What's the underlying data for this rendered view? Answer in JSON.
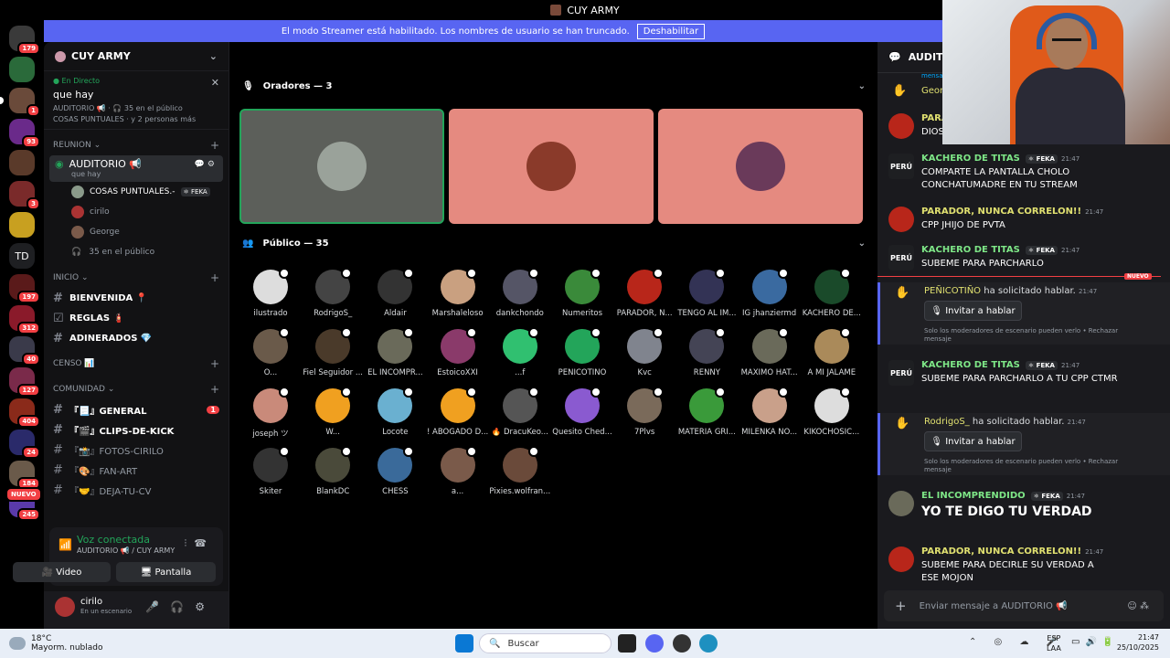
{
  "window": {
    "title": "CUY ARMY"
  },
  "banner": {
    "text": "El modo Streamer está habilitado. Los nombres de usuario se han truncado.",
    "button": "Deshabilitar"
  },
  "servers": [
    {
      "label": "",
      "badge": "179",
      "color": "#3a3a3a"
    },
    {
      "label": "",
      "badge": "",
      "color": "#2a6a3a"
    },
    {
      "label": "",
      "badge": "1",
      "color": "#6a4a3a"
    },
    {
      "label": "",
      "badge": "93",
      "color": "#6a2a8a"
    },
    {
      "label": "",
      "badge": "",
      "color": "#5a3a2a"
    },
    {
      "label": "",
      "badge": "3",
      "color": "#7a2a2a"
    },
    {
      "label": "",
      "badge": "",
      "color": "#c8a020"
    },
    {
      "label": "TD",
      "badge": "",
      "color": "#1e1f22"
    },
    {
      "label": "",
      "badge": "197",
      "color": "#5a1a1a"
    },
    {
      "label": "",
      "badge": "312",
      "color": "#8a1a2a"
    },
    {
      "label": "",
      "badge": "40",
      "color": "#3a3a4a"
    },
    {
      "label": "",
      "badge": "127",
      "color": "#7a2a4a"
    },
    {
      "label": "",
      "badge": "404",
      "color": "#8a2a1a"
    },
    {
      "label": "",
      "badge": "24",
      "color": "#2a2a6a"
    },
    {
      "label": "",
      "badge": "184",
      "color": "#6a5a4a"
    },
    {
      "label": "",
      "badge": "245",
      "color": "#5a3aaa"
    }
  ],
  "servers_new": "NUEVO",
  "sidebar": {
    "server_name": "CUY ARMY",
    "live": {
      "status": "En Directo",
      "title": "que hay",
      "sub1": "AUDITORIO 📢 · 🎧 35 en el público",
      "sub2": "COSAS PUNTUALES · y 2 personas más"
    },
    "cat_reunion": "REUNION",
    "voice_channel": {
      "name": "AUDITORIO 📢",
      "status": "que hay"
    },
    "voice_users": [
      {
        "name": "COSAS PUNTUALES.-",
        "tag": "FEKA",
        "color": "#8a9a8a"
      },
      {
        "name": "cirilo",
        "tag": "",
        "color": "#a33"
      },
      {
        "name": "George",
        "tag": "",
        "color": "#7a5a4a"
      }
    ],
    "audience": "35 en el público",
    "cat_inicio": "INICIO",
    "inicio_channels": [
      {
        "icon": "#",
        "name": "BIENVENIDA 📍",
        "count": ""
      },
      {
        "icon": "☑",
        "name": "REGLAS 🧯",
        "count": ""
      },
      {
        "icon": "#",
        "name": "ADINERADOS 💎",
        "count": ""
      }
    ],
    "cat_censo": "CENSO 📊",
    "cat_comunidad": "COMUNIDAD",
    "comunidad_channels": [
      {
        "icon": "#",
        "name": "『📃』GENERAL",
        "count": "1",
        "bold": true
      },
      {
        "icon": "#",
        "name": "『🎬』CLIPS-DE-KICK",
        "count": "",
        "bold": true
      },
      {
        "icon": "#",
        "name": "『📸』FOTOS-CIRILO",
        "count": "",
        "bold": false
      },
      {
        "icon": "#",
        "name": "『🎨』FAN-ART",
        "count": "",
        "bold": false
      },
      {
        "icon": "#",
        "name": "『🤝』DEJA-TU-CV",
        "count": "",
        "bold": false
      }
    ]
  },
  "voice_panel": {
    "status": "Voz conectada",
    "location": "AUDITORIO 📢 / CUY ARMY",
    "video": "Video",
    "screen": "Pantalla"
  },
  "user_panel": {
    "name": "cirilo",
    "status": "En un escenario"
  },
  "stage": {
    "speakers_header": "Oradores — 3",
    "speakers": [
      {
        "bg": "#5c5f5a",
        "face": "#9aa29a",
        "selected": true
      },
      {
        "bg": "#e58a80",
        "face": "#8a3a2a",
        "selected": false
      },
      {
        "bg": "#e58a80",
        "face": "#6a3a5a",
        "selected": false
      }
    ],
    "public_header": "Público — 35",
    "audience": [
      {
        "name": "ilustrado",
        "c": "#ddd"
      },
      {
        "name": "RodrigoS_",
        "c": "#444"
      },
      {
        "name": "Aldair",
        "c": "#333"
      },
      {
        "name": "Marshaleloso",
        "c": "#c9a080"
      },
      {
        "name": "dankchondo",
        "c": "#556"
      },
      {
        "name": "Numeritos",
        "c": "#3a8a3a"
      },
      {
        "name": "PARADOR, N...",
        "c": "#b8261a"
      },
      {
        "name": "TENGO AL IM...",
        "c": "#335"
      },
      {
        "name": "IG jhanziermd",
        "c": "#3a6aa0"
      },
      {
        "name": "KACHERO DE...",
        "c": "#1a4a2a"
      },
      {
        "name": "O...",
        "c": "#6a5a4a"
      },
      {
        "name": "Fiel Seguidor ...",
        "c": "#4a3a2a"
      },
      {
        "name": "EL INCOMPR...",
        "c": "#6a6a5a"
      },
      {
        "name": "EstoicoXXI",
        "c": "#8a3a6a"
      },
      {
        "name": "...f",
        "c": "#30c070"
      },
      {
        "name": "PEÑICOTIÑO",
        "c": "#23a55a"
      },
      {
        "name": "Kvc",
        "c": "#80848e"
      },
      {
        "name": "RENNY",
        "c": "#445"
      },
      {
        "name": "MAXIMO HAT...",
        "c": "#6a6a5a"
      },
      {
        "name": "A MI JALAME",
        "c": "#aa8a5a"
      },
      {
        "name": "joseph ツ",
        "c": "#c98a7a"
      },
      {
        "name": "W...",
        "c": "#f0a020"
      },
      {
        "name": "Locote",
        "c": "#6ab0d0"
      },
      {
        "name": "! ABOGADO D...",
        "c": "#f0a020"
      },
      {
        "name": "🔥 DracuKeo...",
        "c": "#555"
      },
      {
        "name": "Quesito Ched...",
        "c": "#8a5ad0"
      },
      {
        "name": "7Plvs",
        "c": "#7a6a5a"
      },
      {
        "name": "MATERIA GRI...",
        "c": "#3a9a3a"
      },
      {
        "name": "MILENKA NO...",
        "c": "#c9a08a"
      },
      {
        "name": "KIKOCHOSIC...",
        "c": "#ddd"
      },
      {
        "name": "Skiter",
        "c": "#333"
      },
      {
        "name": "BlankDC",
        "c": "#4a4a3a"
      },
      {
        "name": "CHESS",
        "c": "#3a6a9a"
      },
      {
        "name": "a...",
        "c": "#7a5a4a"
      },
      {
        "name": "Pixies.wolfran...",
        "c": "#6a4a3a"
      }
    ]
  },
  "chat": {
    "channel": "AUDITORIO",
    "partial_top": "mensaje",
    "partial_george": "Georg",
    "partial_parador": "PARA",
    "partial_dios": "DIOS",
    "messages": [
      {
        "author": "KACHERO DE TITAS",
        "tag": "FEKA",
        "time": "21:47",
        "text": "COMPARTE LA PANTALLA CHOLO CONCHATUMADRE EN TU STREAM",
        "color": "#7ee787",
        "av": "#1e1f22",
        "avtext": "PERÚ"
      },
      {
        "author": "PARADOR, NUNCA CORRELON!!",
        "tag": "",
        "time": "21:47",
        "text": "CPP JHIJO DE PVTA",
        "color": "#e0e070",
        "av": "#b8261a",
        "avtext": ""
      },
      {
        "author": "KACHERO DE TITAS",
        "tag": "FEKA",
        "time": "21:47",
        "text": "SUBEME PARA PARCHARLO",
        "color": "#7ee787",
        "av": "#1e1f22",
        "avtext": "PERÚ"
      }
    ],
    "new_label": "NUEVO",
    "requests": [
      {
        "user": "PEÑICOTIÑO",
        "text": "ha solicitado hablar.",
        "time": "21:47",
        "button": "Invitar a hablar",
        "note": "Solo los moderadores de escenario pueden verlo • Rechazar mensaje"
      }
    ],
    "messages2": [
      {
        "author": "KACHERO DE TITAS",
        "tag": "FEKA",
        "time": "21:47",
        "text": "SUBEME PARA PARCHARLO A TU CPP CTMR",
        "color": "#7ee787",
        "av": "#1e1f22",
        "avtext": "PERÚ"
      }
    ],
    "requests2": [
      {
        "user": "RodrigoS_",
        "text": "ha solicitado hablar.",
        "time": "21:47",
        "button": "Invitar a hablar",
        "note": "Solo los moderadores de escenario pueden verlo • Rechazar mensaje"
      }
    ],
    "messages3": [
      {
        "author": "EL INCOMPRENDIDO",
        "tag": "FEKA",
        "time": "21:47",
        "text": "YO TE DIGO TU VERDAD",
        "color": "#7ee787",
        "av": "#6a6a5a",
        "avtext": ""
      },
      {
        "author": "PARADOR, NUNCA CORRELON!!",
        "tag": "",
        "time": "21:47",
        "text": "SUBEME PARA DECIRLE SU VERDAD A ESE MOJON",
        "color": "#e0e070",
        "av": "#b8261a",
        "avtext": ""
      }
    ],
    "input_placeholder": "Enviar mensaje a AUDITORIO 📢"
  },
  "taskbar": {
    "temp": "18°C",
    "weather": "Mayorm. nublado",
    "search": "Buscar",
    "lang1": "ESP",
    "lang2": "LAA",
    "time": "21:47",
    "date": "25/10/2025"
  }
}
